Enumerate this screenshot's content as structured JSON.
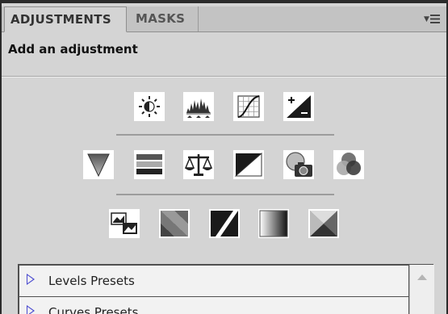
{
  "tabs": [
    {
      "label": "ADJUSTMENTS",
      "active": true
    },
    {
      "label": "MASKS",
      "active": false
    }
  ],
  "panel_menu": {
    "icon": "panel-menu-icon"
  },
  "header": {
    "title": "Add an adjustment"
  },
  "adjustment_rows": [
    [
      "brightness-contrast-icon",
      "levels-icon",
      "curves-icon",
      "exposure-icon"
    ],
    [
      "vibrance-icon",
      "hue-saturation-icon",
      "color-balance-icon",
      "black-white-icon",
      "photo-filter-icon",
      "channel-mixer-icon"
    ],
    [
      "invert-icon",
      "posterize-icon",
      "threshold-icon",
      "gradient-map-icon",
      "selective-color-icon"
    ]
  ],
  "presets": {
    "items": [
      {
        "label": "Levels Presets"
      },
      {
        "label": "Curves Presets"
      }
    ]
  },
  "colors": {
    "panel_bg": "#d4d4d4",
    "tab_bar": "#c3c3c3",
    "preset_arrow": "#4a4ad0"
  }
}
